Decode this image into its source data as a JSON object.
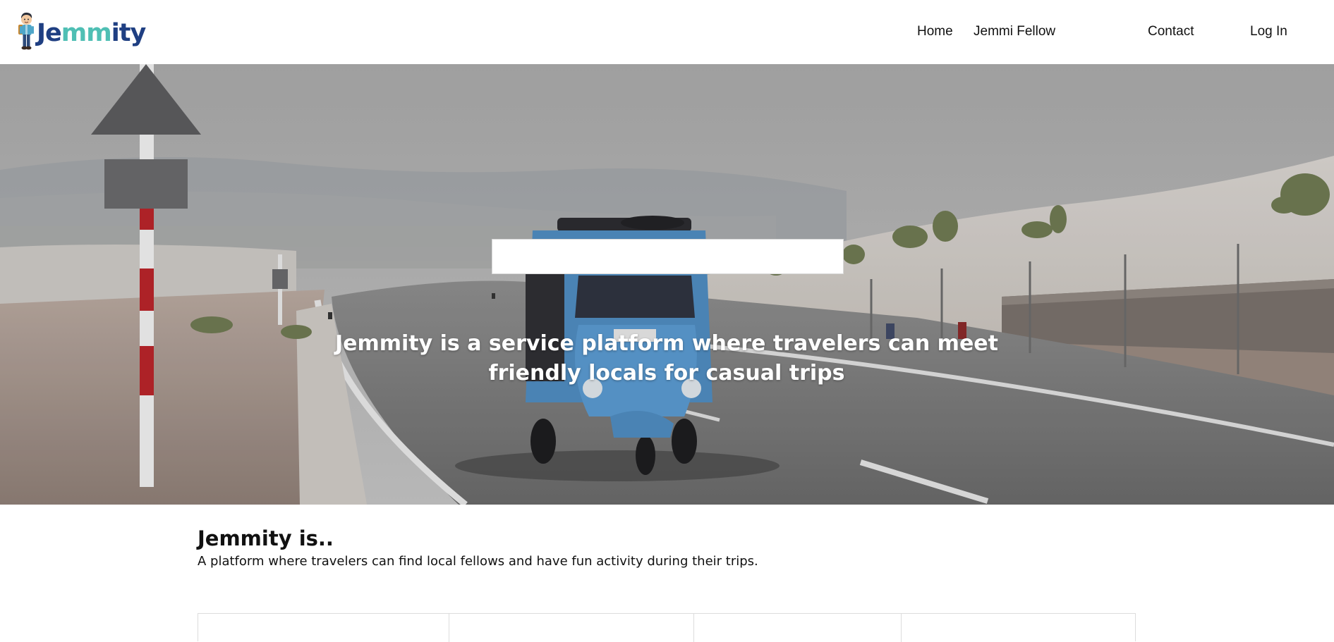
{
  "header": {
    "logo": {
      "text_part1": "Je",
      "text_part2": "mm",
      "text_part3": "ity",
      "mascot_icon": "traveler-mascot-icon",
      "colors": {
        "dark": "#1f3f82",
        "teal": "#4fbfb4"
      }
    },
    "nav": [
      {
        "label": "Home"
      },
      {
        "label": "Jemmi Fellow"
      },
      {
        "label": "Contact"
      },
      {
        "label": "Log In"
      }
    ]
  },
  "hero": {
    "background_scene": "desert-road-with-blue-tuk-tuk-image",
    "search": {
      "value": "",
      "placeholder": ""
    },
    "tagline_line1": "Jemmity is a service platform where travelers can meet",
    "tagline_line2": "friendly locals for casual trips"
  },
  "about": {
    "title": "Jemmity is..",
    "description": "A platform where travelers can find local fellows and have fun activity during their trips."
  },
  "features": {
    "cells": [
      {},
      {},
      {},
      {}
    ]
  }
}
